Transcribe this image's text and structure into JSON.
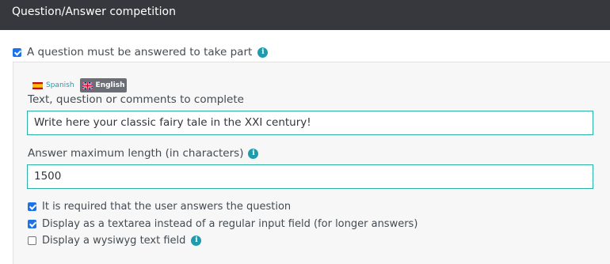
{
  "header": {
    "title": "Question/Answer competition"
  },
  "question_required": {
    "label": "A question must be answered to take part",
    "checked": true,
    "icon": "info-icon"
  },
  "languages": [
    {
      "name": "Spanish",
      "icon": "spain-flag-icon",
      "active": false
    },
    {
      "name": "English",
      "icon": "uk-flag-icon",
      "active": true
    }
  ],
  "question_field": {
    "label": "Text, question or comments to complete",
    "value": "Write here your classic fairy tale in the XXI century!"
  },
  "max_length_field": {
    "label": "Answer maximum length (in characters)",
    "value": "1500",
    "icon": "info-icon"
  },
  "options": [
    {
      "label": "It is required that the user answers the question",
      "checked": true
    },
    {
      "label": "Display as a textarea instead of a regular input field (for longer answers)",
      "checked": true
    },
    {
      "label": "Display a wysiwyg text field",
      "checked": false,
      "icon": "info-icon"
    }
  ],
  "colors": {
    "accent": "#1f9bae",
    "input_border": "#29b1a6",
    "checkbox": "#1d72e6",
    "header_bg": "#37383d"
  }
}
